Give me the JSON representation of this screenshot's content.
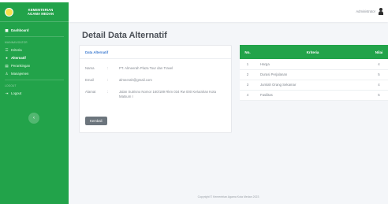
{
  "brand": {
    "line1": "KEMENTERIAN",
    "line2": "AGAMA MEDAN"
  },
  "sidebar": {
    "items": [
      {
        "label": "Dashboard",
        "icon": "dashboard-icon"
      },
      {
        "section": "MAINNAVIGATOR"
      },
      {
        "label": "Kriteria",
        "icon": "list-icon"
      },
      {
        "label": "Alternatif",
        "icon": "users-icon"
      },
      {
        "label": "Perankingan",
        "icon": "ranking-icon"
      },
      {
        "label": "Manajemen",
        "icon": "user-icon"
      },
      {
        "section": "LOGOUT"
      },
      {
        "label": "Logout",
        "icon": "logout-icon"
      }
    ],
    "toggle_icon": "chevron-left-icon"
  },
  "topbar": {
    "user_name": "Administrator"
  },
  "page": {
    "title": "Detail Data Alternatif"
  },
  "card": {
    "header": "Data Alternatif",
    "rows": [
      {
        "label": "Nama",
        "sep": ":",
        "value": "PT. Almeerah Plaza Tour dan Travel"
      },
      {
        "label": "Email",
        "sep": ":",
        "value": "almeerah@gmail.com"
      },
      {
        "label": "Alamat",
        "sep": ":",
        "value": "Jalan Sutrisno Nomor 160/189 Rkm 034 Rw 000 Kelurahan Kota Matsum I"
      }
    ],
    "button": "Kembali"
  },
  "table": {
    "headers": {
      "no": "No.",
      "kriteria": "Kriteria",
      "nilai": "Nilai"
    },
    "rows": [
      {
        "no": "1",
        "kriteria": "Harga",
        "nilai": "4"
      },
      {
        "no": "2",
        "kriteria": "Durasi Perjalanan",
        "nilai": "5"
      },
      {
        "no": "3",
        "kriteria": "Jumlah Orang Sekamar",
        "nilai": "4"
      },
      {
        "no": "4",
        "kriteria": "Fasilitas",
        "nilai": "5"
      }
    ]
  },
  "footer": {
    "text": "Copyright © Kementrian Agama Kota Medan 2023"
  },
  "colors": {
    "sidebar": "#22a34a",
    "accent": "#3d7bd0",
    "button": "#6c757d"
  }
}
